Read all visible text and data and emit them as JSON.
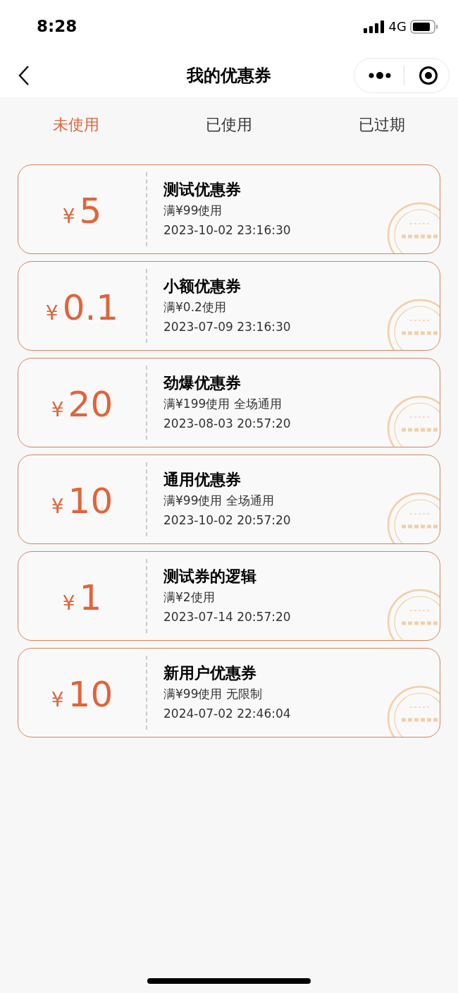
{
  "status_bar": {
    "time": "8:28",
    "network": "4G"
  },
  "nav": {
    "title": "我的优惠券"
  },
  "tabs": [
    {
      "label": "未使用",
      "selected": true
    },
    {
      "label": "已使用",
      "selected": false
    },
    {
      "label": "已过期",
      "selected": false
    }
  ],
  "coupons": [
    {
      "currency": "¥",
      "amount": "5",
      "title": "测试优惠券",
      "condition": "满¥99使用",
      "expiry": "2023-10-02 23:16:30"
    },
    {
      "currency": "¥",
      "amount": "0.1",
      "title": "小额优惠券",
      "condition": "满¥0.2使用",
      "expiry": "2023-07-09 23:16:30"
    },
    {
      "currency": "¥",
      "amount": "20",
      "title": "劲爆优惠券",
      "condition": "满¥199使用 全场通用",
      "expiry": "2023-08-03 20:57:20"
    },
    {
      "currency": "¥",
      "amount": "10",
      "title": "通用优惠券",
      "condition": "满¥99使用 全场通用",
      "expiry": "2023-10-02 20:57:20"
    },
    {
      "currency": "¥",
      "amount": "1",
      "title": "测试券的逻辑",
      "condition": "满¥2使用",
      "expiry": "2023-07-14 20:57:20"
    },
    {
      "currency": "¥",
      "amount": "10",
      "title": "新用户优惠券",
      "condition": "满¥99使用 无限制",
      "expiry": "2024-07-02 22:46:04"
    }
  ]
}
